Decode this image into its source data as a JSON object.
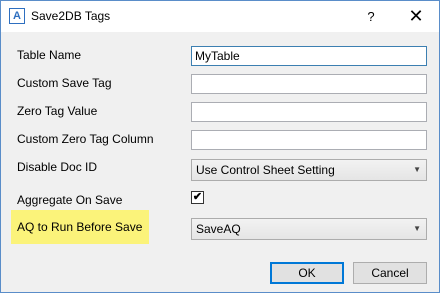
{
  "window": {
    "title": "Save2DB Tags",
    "app_icon_letter": "A",
    "help_glyph": "?",
    "close_glyph": "✕"
  },
  "form": {
    "table_name": {
      "label": "Table Name",
      "value": "MyTable"
    },
    "custom_save_tag": {
      "label": "Custom Save Tag",
      "value": ""
    },
    "zero_tag_value": {
      "label": "Zero Tag Value",
      "value": ""
    },
    "custom_zero_tag_column": {
      "label": "Custom Zero Tag Column",
      "value": ""
    },
    "disable_doc_id": {
      "label": "Disable Doc ID",
      "selected": "Use Control Sheet Setting"
    },
    "aggregate_on_save": {
      "label": "Aggregate On Save",
      "checked": true,
      "check_glyph": "✔"
    },
    "aq_to_run": {
      "label": "AQ to Run Before Save",
      "selected": "SaveAQ",
      "highlight_color": "#fbf37a"
    }
  },
  "buttons": {
    "ok_label": "OK",
    "cancel_label": "Cancel"
  },
  "icons": {
    "dropdown": "chevron-down-icon"
  },
  "colors": {
    "window_border": "#5a8dc9",
    "dialog_background": "#f0f0f0",
    "default_button_border": "#0078d7"
  }
}
